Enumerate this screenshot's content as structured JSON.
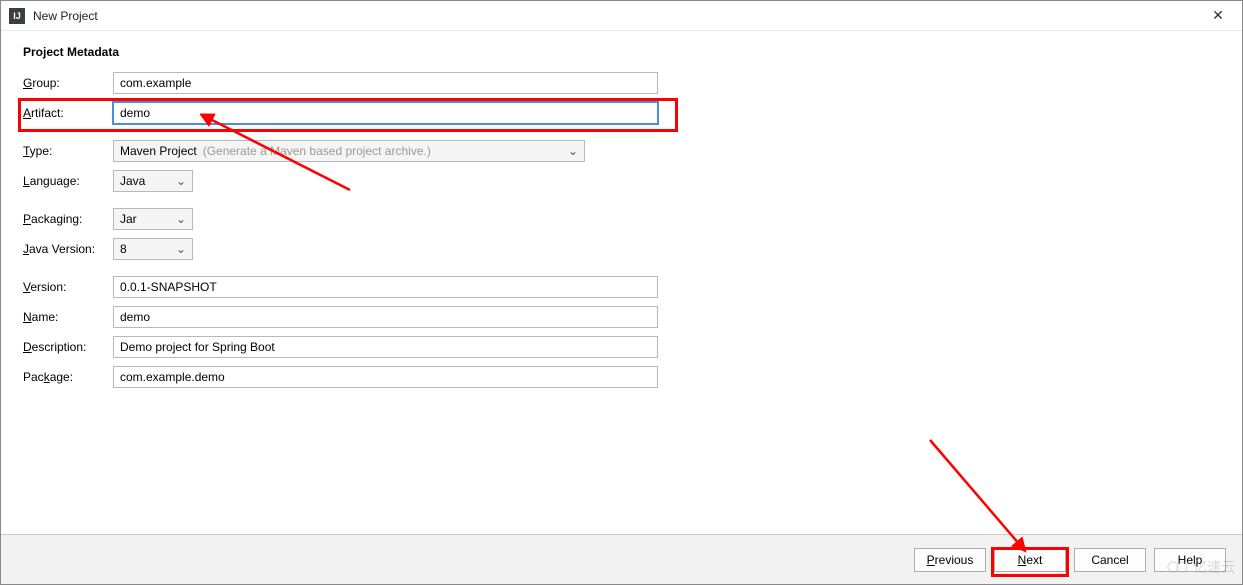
{
  "window": {
    "title": "New Project",
    "icon_label": "IJ"
  },
  "section": {
    "title": "Project Metadata"
  },
  "labels": {
    "group": "roup:",
    "group_mnemonic": "G",
    "artifact": "rtifact:",
    "artifact_mnemonic": "A",
    "type": "ype:",
    "type_mnemonic": "T",
    "language": "anguage:",
    "language_mnemonic": "L",
    "packaging": "ackaging:",
    "packaging_mnemonic": "P",
    "java_version": "ava Version:",
    "java_version_mnemonic": "J",
    "version": "ersion:",
    "version_mnemonic": "V",
    "name": "ame:",
    "name_mnemonic": "N",
    "description": "escription:",
    "description_mnemonic": "D",
    "package": "age:",
    "package_mnemonic": "k",
    "package_prefix": "Pac"
  },
  "fields": {
    "group": "com.example",
    "artifact": "demo",
    "type": "Maven Project",
    "type_hint": "(Generate a Maven based project archive.)",
    "language": "Java",
    "packaging": "Jar",
    "java_version": "8",
    "version": "0.0.1-SNAPSHOT",
    "name": "demo",
    "description": "Demo project for Spring Boot",
    "package": "com.example.demo"
  },
  "buttons": {
    "previous": "revious",
    "previous_mnemonic": "P",
    "next": "ext",
    "next_mnemonic": "N",
    "cancel": "Cancel",
    "help": "Help"
  },
  "watermark": {
    "text": "亿速云"
  },
  "annotations": {
    "color": "#ff0000"
  }
}
